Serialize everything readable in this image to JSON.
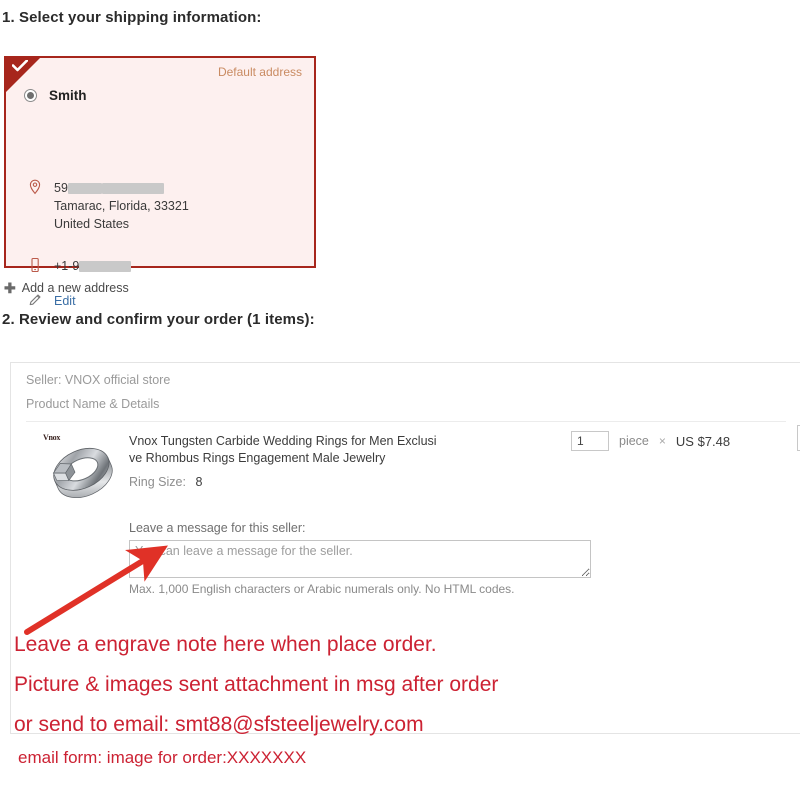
{
  "step1": {
    "heading": "1. Select your shipping information:",
    "address_card": {
      "default_tag": "Default address",
      "recipient": "Smith",
      "street_prefix": "59",
      "city_state_zip": "Tamarac, Florida, 33321",
      "country": "United States",
      "phone_prefix": "+1-9",
      "edit_label": "Edit",
      "selected": true,
      "border_color": "#a7261c",
      "background_color": "#fdf0ef",
      "tag_color": "#c98b62"
    },
    "add_address_label": "Add a new address"
  },
  "step2": {
    "heading": "2. Review and confirm your order (1 items):",
    "seller_line": "Seller: VNOX official store",
    "product_col_header": "Product Name & Details",
    "item": {
      "title": "Vnox Tungsten Carbide Wedding Rings for Men Exclusive Rhombus Rings Engagement Male Jewelry",
      "watermark": "Vnox",
      "ring_size_label": "Ring Size:",
      "ring_size_value": "8",
      "quantity": "1",
      "unit": "piece",
      "times_symbol": "×",
      "unit_price": "US $7.48"
    },
    "message": {
      "label": "Leave a message for this seller:",
      "placeholder": "You can leave a message for the seller.",
      "value": "",
      "hint": "Max. 1,000 English characters or Arabic numerals only. No HTML codes."
    }
  },
  "annotation": {
    "color": "#cc2233",
    "line1": "Leave a engrave note here when place order.",
    "line2": "Picture & images sent attachment in msg after order",
    "line3": "or send to email: smt88@sfsteeljewelry.com",
    "line4": "email form: image for order:XXXXXXX"
  }
}
